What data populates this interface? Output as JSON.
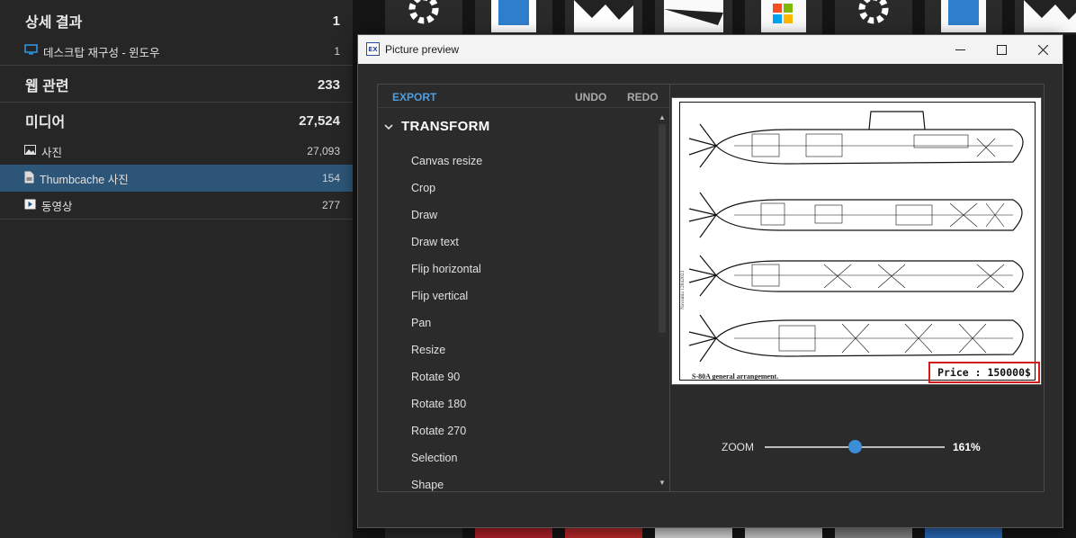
{
  "left_panel": {
    "categories": [
      {
        "title": "상세 결과",
        "count": "1",
        "items": [
          {
            "label": "데스크탑 재구성 - 윈도우",
            "count": "1",
            "icon": "monitor-icon"
          }
        ]
      },
      {
        "title": "웹 관련",
        "count": "233",
        "items": []
      },
      {
        "title": "미디어",
        "count": "27,524",
        "items": [
          {
            "label": "사진",
            "count": "27,093",
            "icon": "image-icon"
          },
          {
            "label": "Thumbcache 사진",
            "count": "154",
            "icon": "file-image-icon",
            "selected": true
          },
          {
            "label": "동영상",
            "count": "277",
            "icon": "play-icon"
          }
        ]
      }
    ]
  },
  "dialog": {
    "title": "Picture preview",
    "app_icon_text": "EX",
    "window_controls": {
      "minimize": "—",
      "maximize": "☐",
      "close": "✕"
    },
    "toolbar": {
      "export": "EXPORT",
      "undo": "UNDO",
      "redo": "REDO"
    },
    "section": {
      "label": "TRANSFORM",
      "expanded": true
    },
    "transform_items": [
      "Canvas resize",
      "Crop",
      "Draw",
      "Draw text",
      "Flip horizontal",
      "Flip vertical",
      "Pan",
      "Resize",
      "Rotate 90",
      "Rotate 180",
      "Rotate 270",
      "Selection",
      "Shape"
    ],
    "preview": {
      "caption": "S-80A general arrangement.",
      "side_caption": "Navantia 12042023",
      "price_label": "Price : 150000$"
    },
    "zoom": {
      "label": "ZOOM",
      "value": "161%",
      "level": 0.5
    }
  },
  "colors": {
    "accent": "#3b8fd8",
    "selection": "#2c5577",
    "price_border": "#d21c1c",
    "export": "#4f9fe0"
  }
}
